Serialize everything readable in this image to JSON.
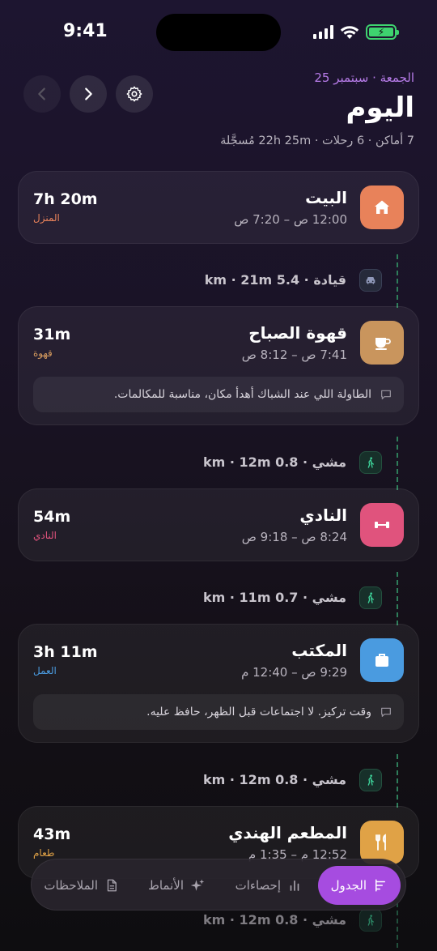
{
  "status": {
    "time": "9:41"
  },
  "header": {
    "date": "الجمعة · سبتمبر 25",
    "title": "اليوم",
    "summary": "7 أماكن · 6 رحلات · 22h 25m مُسجَّلة"
  },
  "places": [
    {
      "name": "البيت",
      "time": "12:00 ص – 7:20 ص",
      "duration": "7h 20m",
      "category": "المنزل",
      "icon": "home-icon",
      "color": "#e8825a",
      "cat_color": "#e8825a"
    },
    {
      "name": "قهوة الصباح",
      "time": "7:41 ص – 8:12 ص",
      "duration": "31m",
      "category": "قهوة",
      "icon": "coffee-icon",
      "color": "#c9955d",
      "cat_color": "#d59a5e",
      "note": "الطاولة اللي عند الشباك أهدأ مكان، مناسبة للمكالمات."
    },
    {
      "name": "النادي",
      "time": "8:24 ص – 9:18 ص",
      "duration": "54m",
      "category": "النادي",
      "icon": "dumbbell-icon",
      "color": "#e0537d",
      "cat_color": "#e0537d"
    },
    {
      "name": "المكتب",
      "time": "9:29 ص – 12:40 م",
      "duration": "3h 11m",
      "category": "العمل",
      "icon": "briefcase-icon",
      "color": "#4a9be0",
      "cat_color": "#4a9be0",
      "note": "وقت تركيز. لا اجتماعات قبل الظهر، حافظ عليه."
    },
    {
      "name": "المطعم الهندي",
      "time": "12:52 م – 1:35 م",
      "duration": "43m",
      "category": "طعام",
      "icon": "utensils-icon",
      "color": "#e0a246",
      "cat_color": "#e0a246"
    }
  ],
  "trips": [
    {
      "mode": "قيادة",
      "text": "قيادة · 5.4 km · 21m",
      "icon": "car-icon"
    },
    {
      "mode": "مشي",
      "text": "مشي · 0.8 km · 12m",
      "icon": "walk-icon"
    },
    {
      "mode": "مشي",
      "text": "مشي · 0.7 km · 11m",
      "icon": "walk-icon"
    },
    {
      "mode": "مشي",
      "text": "مشي · 0.8 km · 12m",
      "icon": "walk-icon"
    },
    {
      "mode": "مشي",
      "text": "مشي · 0.8 km · 12m",
      "icon": "walk-icon"
    }
  ],
  "tabs": [
    {
      "label": "الجدول",
      "icon": "timeline-icon",
      "active": true
    },
    {
      "label": "إحصاءات",
      "icon": "bar-chart-icon"
    },
    {
      "label": "الأنماط",
      "icon": "sparkle-icon"
    },
    {
      "label": "الملاحظات",
      "icon": "document-icon"
    }
  ],
  "colors": {
    "accent": "#a64ce0",
    "date": "#b67be8",
    "trip_line": "#2e7d5a",
    "battery": "#3ed36f"
  }
}
